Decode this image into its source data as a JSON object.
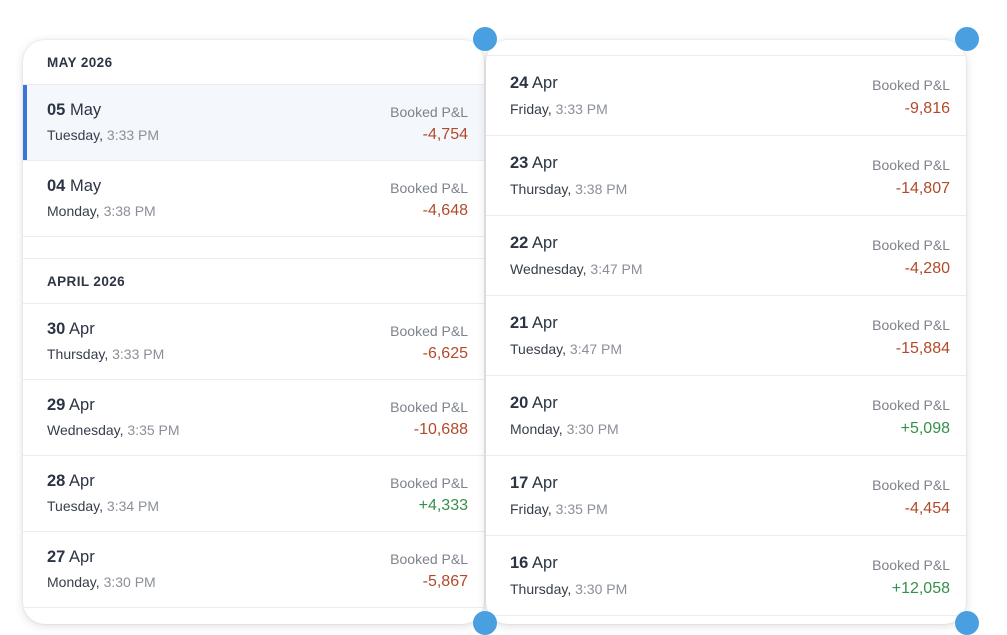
{
  "colors": {
    "negative": "#b24a2a",
    "positive": "#35904a",
    "selected_accent": "#3b76d6",
    "handle": "#4a9fe0"
  },
  "left_panel": {
    "sections": [
      {
        "header": "MAY 2026",
        "entries": [
          {
            "day": "05",
            "month": "May",
            "weekday": "Tuesday,",
            "time": "3:33 PM",
            "label": "Booked P&L",
            "value": "-4,754",
            "sign": "negative",
            "selected": true
          },
          {
            "day": "04",
            "month": "May",
            "weekday": "Monday,",
            "time": "3:38 PM",
            "label": "Booked P&L",
            "value": "-4,648",
            "sign": "negative",
            "selected": false
          }
        ]
      },
      {
        "header": "APRIL 2026",
        "entries": [
          {
            "day": "30",
            "month": "Apr",
            "weekday": "Thursday,",
            "time": "3:33 PM",
            "label": "Booked P&L",
            "value": "-6,625",
            "sign": "negative",
            "selected": false
          },
          {
            "day": "29",
            "month": "Apr",
            "weekday": "Wednesday,",
            "time": "3:35 PM",
            "label": "Booked P&L",
            "value": "-10,688",
            "sign": "negative",
            "selected": false
          },
          {
            "day": "28",
            "month": "Apr",
            "weekday": "Tuesday,",
            "time": "3:34 PM",
            "label": "Booked P&L",
            "value": "+4,333",
            "sign": "positive",
            "selected": false
          },
          {
            "day": "27",
            "month": "Apr",
            "weekday": "Monday,",
            "time": "3:30 PM",
            "label": "Booked P&L",
            "value": "-5,867",
            "sign": "negative",
            "selected": false
          }
        ]
      }
    ]
  },
  "right_panel": {
    "entries": [
      {
        "day": "24",
        "month": "Apr",
        "weekday": "Friday,",
        "time": "3:33 PM",
        "label": "Booked P&L",
        "value": "-9,816",
        "sign": "negative"
      },
      {
        "day": "23",
        "month": "Apr",
        "weekday": "Thursday,",
        "time": "3:38 PM",
        "label": "Booked P&L",
        "value": "-14,807",
        "sign": "negative"
      },
      {
        "day": "22",
        "month": "Apr",
        "weekday": "Wednesday,",
        "time": "3:47 PM",
        "label": "Booked P&L",
        "value": "-4,280",
        "sign": "negative"
      },
      {
        "day": "21",
        "month": "Apr",
        "weekday": "Tuesday,",
        "time": "3:47 PM",
        "label": "Booked P&L",
        "value": "-15,884",
        "sign": "negative"
      },
      {
        "day": "20",
        "month": "Apr",
        "weekday": "Monday,",
        "time": "3:30 PM",
        "label": "Booked P&L",
        "value": "+5,098",
        "sign": "positive"
      },
      {
        "day": "17",
        "month": "Apr",
        "weekday": "Friday,",
        "time": "3:35 PM",
        "label": "Booked P&L",
        "value": "-4,454",
        "sign": "negative"
      },
      {
        "day": "16",
        "month": "Apr",
        "weekday": "Thursday,",
        "time": "3:30 PM",
        "label": "Booked P&L",
        "value": "+12,058",
        "sign": "positive"
      }
    ]
  }
}
